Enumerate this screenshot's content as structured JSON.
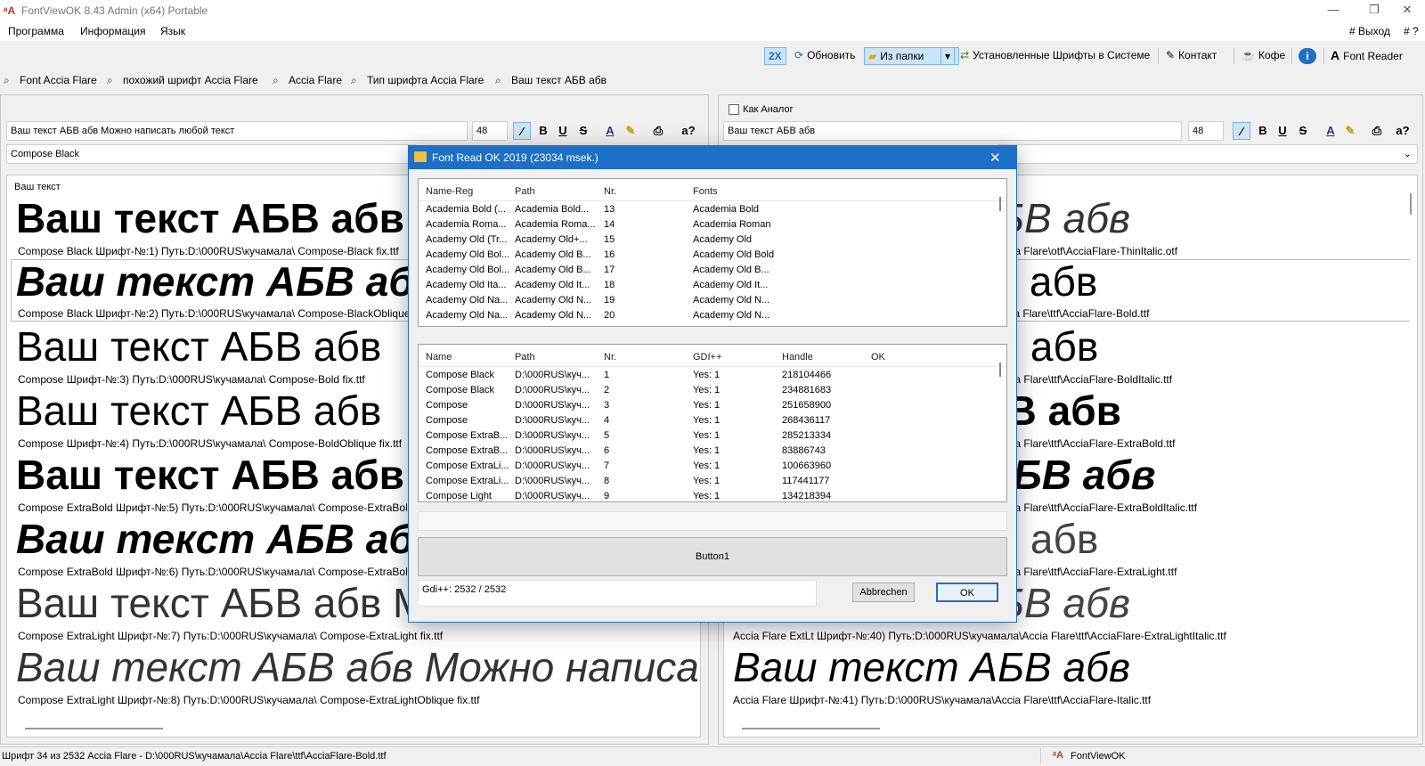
{
  "window": {
    "title": "FontViewOK 8.43 Admin (x64) Portable",
    "minimize": "—",
    "maximize": "❐",
    "close": "✕"
  },
  "menu": {
    "items": [
      "Программа",
      "Информация",
      "Язык"
    ],
    "exit": "# Выход",
    "help": "# ?"
  },
  "toolbar": {
    "zoom": "2X",
    "refresh": "Обновить",
    "from_folder": "Из папки",
    "installed": "Установленные Шрифты в Системе",
    "contact": "Контакт",
    "coffee": "Кофе",
    "font_reader": "Font Reader"
  },
  "tabs": [
    "Font Accia Flare",
    "похожий шрифт  Accia Flare",
    "Accia Flare",
    "Тип шрифта  Accia Flare",
    "Ваш текст АБВ абв"
  ],
  "left": {
    "text_input": "Ваш текст АБВ абв Можно написать любой текст",
    "size": "48",
    "font_select": "Compose Black",
    "preview_label": "Ваш текст",
    "samples": [
      {
        "text": "Ваш текст АБВ абв",
        "caption": "Compose Black Шрифт-№:1) Путь:D:\\000RUS\\кучамала\\ Compose-Black fix.ttf"
      },
      {
        "text": "Ваш текст АБВ абв",
        "caption": "Compose Black Шрифт-№:2) Путь:D:\\000RUS\\кучамала\\ Compose-BlackOblique fix.ttf"
      },
      {
        "text": "Ваш текст АБВ абв",
        "caption": "Compose Шрифт-№:3) Путь:D:\\000RUS\\кучамала\\ Compose-Bold fix.ttf"
      },
      {
        "text": "Ваш текст АБВ абв",
        "caption": "Compose Шрифт-№:4) Путь:D:\\000RUS\\кучамала\\ Compose-BoldOblique fix.ttf"
      },
      {
        "text": "Ваш текст АБВ абв",
        "caption": "Compose ExtraBold Шрифт-№:5) Путь:D:\\000RUS\\кучамала\\ Compose-ExtraBold fix.ttf"
      },
      {
        "text": "Ваш текст АБВ абв",
        "caption": "Compose ExtraBold Шрифт-№:6) Путь:D:\\000RUS\\кучамала\\ Compose-ExtraBoldOblique fix.ttf"
      },
      {
        "text": "Ваш текст АБВ абв Можно написать",
        "caption": "Compose ExtraLight Шрифт-№:7) Путь:D:\\000RUS\\кучамала\\ Compose-ExtraLight fix.ttf"
      },
      {
        "text": "Ваш текст АБВ абв Можно написать",
        "caption": "Compose ExtraLight Шрифт-№:8) Путь:D:\\000RUS\\кучамала\\ Compose-ExtraLightOblique fix.ttf"
      }
    ]
  },
  "right": {
    "analog_label": "Как Аналог",
    "text_input": "Ваш текст АБВ абв",
    "size": "48",
    "samples": [
      {
        "text": "Ваш текст АБВ абв",
        "caption": "Accia Flare Шрифт-№:34) Путь:D:\\000RUS\\кучамала\\Accia Flare\\otf\\AcciaFlare-ThinItalic.otf"
      },
      {
        "text": "Ваш текст АБВ абв",
        "caption": "Accia Flare Шрифт-№:35) Путь:D:\\000RUS\\кучамала\\Accia Flare\\ttf\\AcciaFlare-Bold.ttf"
      },
      {
        "text": "Ваш текст АБВ абв",
        "caption": "Accia Flare Шрифт-№:36) Путь:D:\\000RUS\\кучамала\\Accia Flare\\ttf\\AcciaFlare-BoldItalic.ttf"
      },
      {
        "text": "Ваш текст АБВ абв",
        "caption": "Accia Flare Шрифт-№:37) Путь:D:\\000RUS\\кучамала\\Accia Flare\\ttf\\AcciaFlare-ExtraBold.ttf"
      },
      {
        "text": "Ваш текст АБВ абв",
        "caption": "Accia Flare Шрифт-№:38) Путь:D:\\000RUS\\кучамала\\Accia Flare\\ttf\\AcciaFlare-ExtraBoldItalic.ttf"
      },
      {
        "text": "Ваш текст АБВ абв",
        "caption": "Accia Flare Шрифт-№:39) Путь:D:\\000RUS\\кучамала\\Accia Flare\\ttf\\AcciaFlare-ExtraLight.ttf"
      },
      {
        "text": "Ваш текст АБВ абв",
        "caption": "Accia Flare ExtLt Шрифт-№:40) Путь:D:\\000RUS\\кучамала\\Accia Flare\\ttf\\AcciaFlare-ExtraLightItalic.ttf"
      },
      {
        "text": "Ваш текст АБВ абв",
        "caption": "Accia Flare Шрифт-№:41) Путь:D:\\000RUS\\кучамала\\Accia Flare\\ttf\\AcciaFlare-Italic.ttf"
      }
    ]
  },
  "dialog": {
    "title": "Font Read OK 2019 (23034 msek.)",
    "list1": {
      "headers": [
        "Name-Reg",
        "Path",
        "Nr.",
        "Fonts"
      ],
      "rows": [
        [
          "Academia Bold (...",
          "Academia Bold...",
          "13",
          "Academia Bold"
        ],
        [
          "Academia Roma...",
          "Academia Roma...",
          "14",
          "Academia Roman"
        ],
        [
          "Academy Old (Tr...",
          "Academy Old+...",
          "15",
          "Academy Old"
        ],
        [
          "Academy Old Bol...",
          "Academy Old B...",
          "16",
          "Academy Old Bold"
        ],
        [
          "Academy Old Bol...",
          "Academy Old B...",
          "17",
          "Academy Old B..."
        ],
        [
          "Academy Old Ita...",
          "Academy Old It...",
          "18",
          "Academy Old It..."
        ],
        [
          "Academy Old Na...",
          "Academy Old N...",
          "19",
          "Academy Old N..."
        ],
        [
          "Academy Old Na...",
          "Academy Old N...",
          "20",
          "Academy Old N..."
        ]
      ]
    },
    "list2": {
      "headers": [
        "Name",
        "Path",
        "Nr.",
        "GDI++",
        "Handle",
        "OK"
      ],
      "rows": [
        [
          "Compose Black",
          "D:\\000RUS\\куч...",
          "1",
          "Yes: 1",
          "218104466"
        ],
        [
          "Compose Black",
          "D:\\000RUS\\куч...",
          "2",
          "Yes: 1",
          "234881683"
        ],
        [
          "Compose",
          "D:\\000RUS\\куч...",
          "3",
          "Yes: 1",
          "251658900"
        ],
        [
          "Compose",
          "D:\\000RUS\\куч...",
          "4",
          "Yes: 1",
          "268436117"
        ],
        [
          "Compose ExtraB...",
          "D:\\000RUS\\куч...",
          "5",
          "Yes: 1",
          "285213334"
        ],
        [
          "Compose ExtraB...",
          "D:\\000RUS\\куч...",
          "6",
          "Yes: 1",
          "83886743"
        ],
        [
          "Compose ExtraLi...",
          "D:\\000RUS\\куч...",
          "7",
          "Yes: 1",
          "100663960"
        ],
        [
          "Compose ExtraLi...",
          "D:\\000RUS\\куч...",
          "8",
          "Yes: 1",
          "117441177"
        ],
        [
          "Compose Light",
          "D:\\000RUS\\куч...",
          "9",
          "Yes: 1",
          "134218394"
        ]
      ]
    },
    "button1": "Button1",
    "gdi_status": "Gdi++: 2532 / 2532",
    "cancel": "Abbrechen",
    "ok": "OK"
  },
  "status": {
    "text": "Шрифт 34 из 2532 Accia Flare - D:\\000RUS\\кучамала\\Accia Flare\\ttf\\AcciaFlare-Bold.ttf",
    "app": "FontViewOK"
  }
}
